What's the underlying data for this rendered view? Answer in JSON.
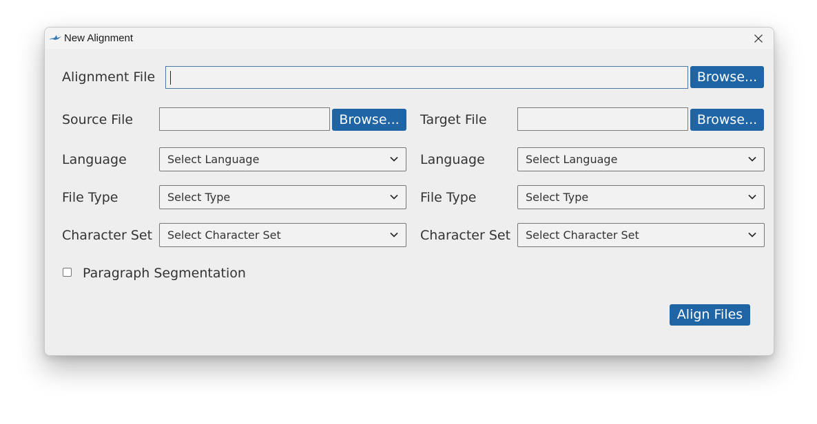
{
  "window": {
    "title": "New Alignment",
    "close_icon": "close-icon",
    "app_icon": "bird-icon"
  },
  "alignment": {
    "label": "Alignment File",
    "value": "",
    "browse_label": "Browse..."
  },
  "source": {
    "file_label": "Source File",
    "file_value": "",
    "browse_label": "Browse...",
    "language_label": "Language",
    "language_value": "Select Language",
    "filetype_label": "File Type",
    "filetype_value": "Select Type",
    "charset_label": "Character Set",
    "charset_value": "Select Character Set"
  },
  "target": {
    "file_label": "Target File",
    "file_value": "",
    "browse_label": "Browse...",
    "language_label": "Language",
    "language_value": "Select Language",
    "filetype_label": "File Type",
    "filetype_value": "Select Type",
    "charset_label": "Character Set",
    "charset_value": "Select Character Set"
  },
  "options": {
    "paragraph_segmentation_label": "Paragraph Segmentation",
    "paragraph_segmentation_checked": false
  },
  "actions": {
    "align_label": "Align Files"
  },
  "colors": {
    "accent": "#1f64a5",
    "dialog_bg": "#eeeeee",
    "titlebar_bg": "#f3f3f3",
    "field_bg": "#f2f2f2",
    "text": "#333333"
  }
}
